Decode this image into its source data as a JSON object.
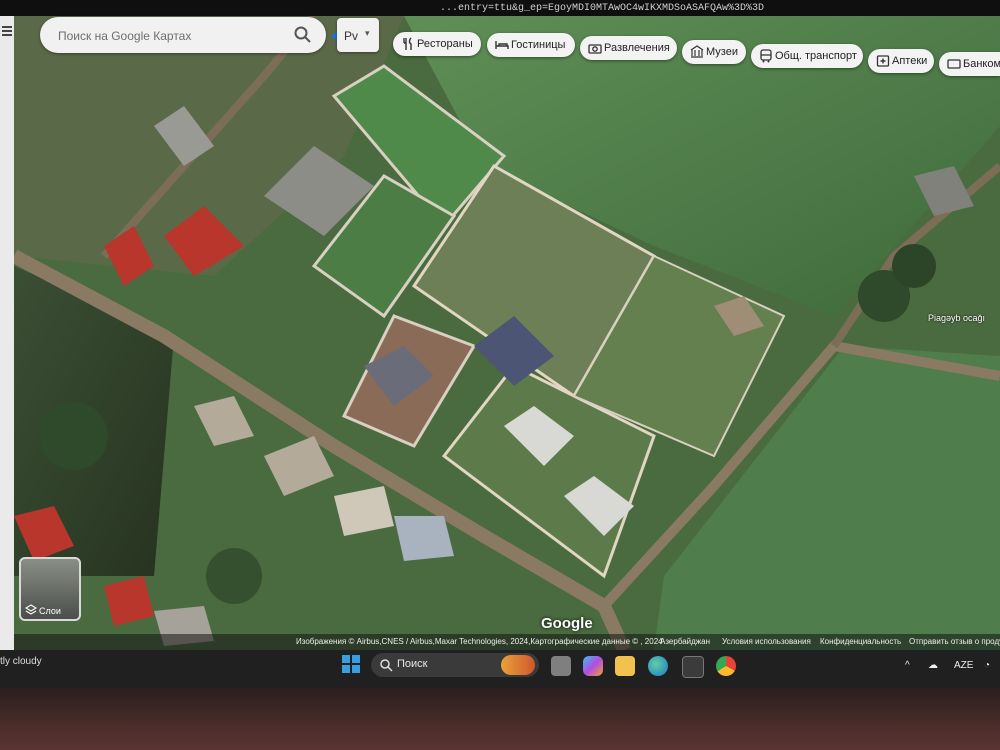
{
  "browser": {
    "url_fragment": "...entry=ttu&g_ep=EgoyMDI0MTAwOC4wIKXMDSoASAFQAw%3D%3D"
  },
  "search": {
    "placeholder": "Поиск на Google Картах"
  },
  "account": {
    "label": "Pv"
  },
  "chips": [
    {
      "label": "Рестораны",
      "icon": "fork-knife-icon"
    },
    {
      "label": "Гостиницы",
      "icon": "bed-icon"
    },
    {
      "label": "Развлечения",
      "icon": "camera-icon"
    },
    {
      "label": "Музеи",
      "icon": "museum-icon"
    },
    {
      "label": "Общ. транспорт",
      "icon": "bus-icon"
    },
    {
      "label": "Аптеки",
      "icon": "pharmacy-icon"
    },
    {
      "label": "Банкоматы",
      "icon": "atm-icon"
    }
  ],
  "map": {
    "place_label": "Piagəyb ocağı",
    "layers_label": "Слои",
    "logo": "Google",
    "colors": {
      "field": "#4f7a48",
      "road": "#8a7a63",
      "roof_red": "#b8362b"
    }
  },
  "attribution": {
    "imagery": "Изображения © Airbus,CNES / Airbus,Maxar Technologies, 2024,Картографические данные © , 2024",
    "country": "Азербайджан",
    "terms": "Условия использования",
    "privacy": "Конфиденциальность",
    "feedback": "Отправить отзыв о продукте"
  },
  "taskbar": {
    "weather": "tly cloudy",
    "search_label": "Поиск",
    "language": "AZE"
  }
}
